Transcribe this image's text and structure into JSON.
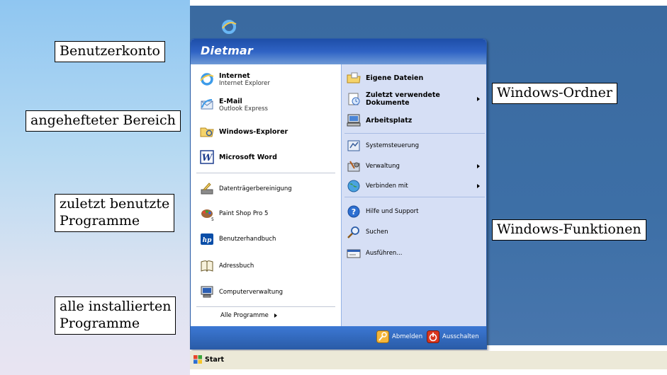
{
  "callouts": {
    "benutzerkonto": "Benutzerkonto",
    "angeheftet": "angehefteter Bereich",
    "zuletzt_line1": "zuletzt benutzte",
    "zuletzt_line2": "Programme",
    "alle_line1": "alle installierten",
    "alle_line2": "Programme",
    "windows_ordner": "Windows-Ordner",
    "windows_funktionen": "Windows-Funktionen"
  },
  "start_menu": {
    "user_name": "Dietmar",
    "pinned": [
      {
        "title": "Internet",
        "subtitle": "Internet Explorer",
        "icon": "internet-explorer-icon"
      },
      {
        "title": "E-Mail",
        "subtitle": "Outlook Express",
        "icon": "outlook-express-icon"
      },
      {
        "title": "Windows-Explorer",
        "icon": "windows-explorer-icon"
      },
      {
        "title": "Microsoft Word",
        "icon": "word-icon"
      }
    ],
    "recent": [
      {
        "label": "Datenträgerbereinigung",
        "icon": "disk-cleanup-icon"
      },
      {
        "label": "Paint Shop Pro 5",
        "icon": "paint-shop-pro-icon"
      },
      {
        "label": "Benutzerhandbuch",
        "icon": "hp-icon"
      },
      {
        "label": "Adressbuch",
        "icon": "address-book-icon"
      },
      {
        "label": "Computerverwaltung",
        "icon": "computer-management-icon"
      }
    ],
    "all_programs": "Alle Programme",
    "folders": [
      {
        "label": "Eigene Dateien",
        "icon": "my-documents-icon"
      },
      {
        "label": "Zuletzt verwendete Dokumente",
        "icon": "recent-documents-icon"
      },
      {
        "label": "Arbeitsplatz",
        "icon": "my-computer-icon"
      }
    ],
    "system": [
      {
        "label": "Systemsteuerung",
        "icon": "control-panel-icon"
      },
      {
        "label": "Verwaltung",
        "icon": "administrative-tools-icon"
      },
      {
        "label": "Verbinden mit",
        "icon": "connect-to-icon"
      }
    ],
    "functions": [
      {
        "label": "Hilfe und Support",
        "icon": "help-icon"
      },
      {
        "label": "Suchen",
        "icon": "search-icon"
      },
      {
        "label": "Ausführen...",
        "icon": "run-icon"
      }
    ],
    "footer": {
      "logoff": "Abmelden",
      "shutdown": "Ausschalten"
    }
  },
  "taskbar": {
    "start_label": "Start"
  },
  "colors": {
    "header_blue": "#1d4ea8",
    "right_column": "#d6dff5",
    "footer_blue": "#2a5ca8",
    "desktop_blue": "#3d6fa6"
  }
}
